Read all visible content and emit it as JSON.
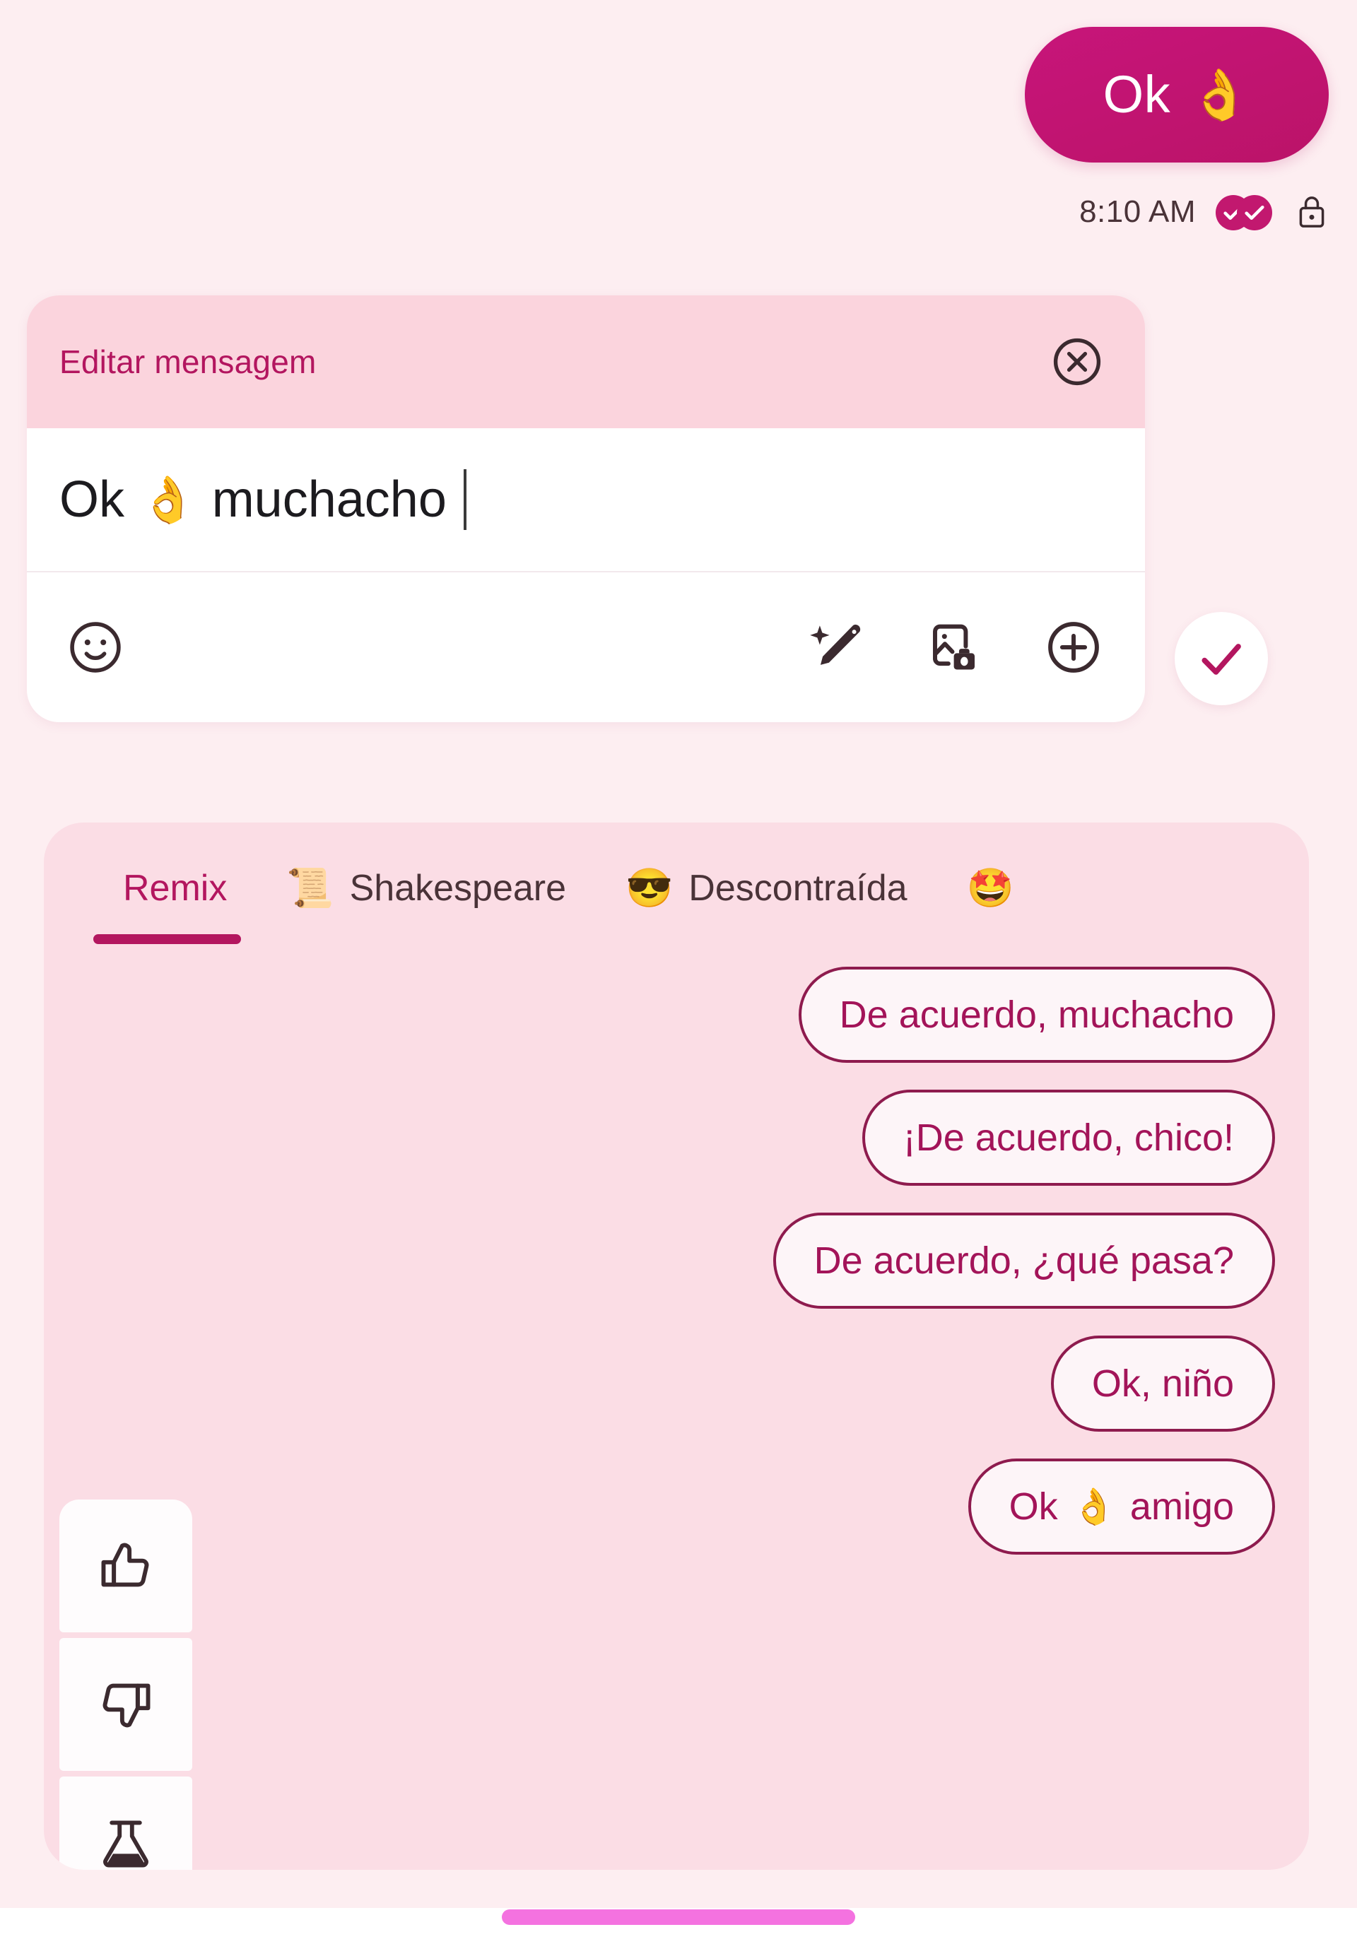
{
  "colors": {
    "background": "#fdeef1",
    "accent": "#c2186f",
    "accent_dark": "#8e1b4e",
    "panel": "#fbdde5",
    "header": "#fbd4dd",
    "text_dark": "#1c1b1f",
    "home_indicator": "#f472e0"
  },
  "chat": {
    "sent_message": {
      "text": "Ok",
      "emoji": "👌",
      "emoji_name": "ok-hand-emoji"
    },
    "meta": {
      "time": "8:10 AM",
      "status_icon": "double-check-read-icon",
      "encryption_icon": "lock-icon"
    }
  },
  "edit_card": {
    "title": "Editar mensagem",
    "close_icon": "close-circle-icon",
    "input": {
      "text_before": "Ok",
      "emoji": "👌",
      "text_after": "muchacho",
      "full_value": "Ok 👌 muchacho",
      "placeholder": "Editar mensagem"
    },
    "toolbar": {
      "emoji_icon": "smiley-icon",
      "magic_icon": "magic-wand-icon",
      "gallery_icon": "gallery-camera-icon",
      "plus_icon": "plus-circle-icon"
    },
    "confirm_icon": "check-icon"
  },
  "remix": {
    "tabs": [
      {
        "label": "Remix",
        "emoji": "",
        "active": true
      },
      {
        "label": "Shakespeare",
        "emoji": "📜",
        "active": false
      },
      {
        "label": "Descontraída",
        "emoji": "😎",
        "active": false
      },
      {
        "label": "",
        "emoji": "🤩",
        "active": false
      }
    ],
    "feedback": [
      {
        "icon": "thumbs-up-icon"
      },
      {
        "icon": "thumbs-down-icon"
      },
      {
        "icon": "lab-flask-icon"
      }
    ],
    "suggestions": [
      {
        "text": "De acuerdo, muchacho",
        "emoji": ""
      },
      {
        "text": "¡De acuerdo, chico!",
        "emoji": ""
      },
      {
        "text": "De acuerdo, ¿qué pasa?",
        "emoji": ""
      },
      {
        "text": "Ok, niño",
        "emoji": ""
      },
      {
        "text_before": "Ok",
        "emoji": "👌",
        "text": "amigo"
      }
    ]
  },
  "system": {
    "home_indicator": "home-indicator-bar"
  }
}
